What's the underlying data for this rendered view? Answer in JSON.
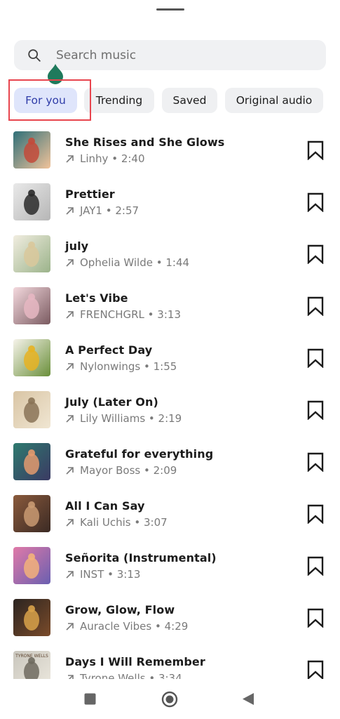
{
  "search": {
    "placeholder": "Search music"
  },
  "tabs": [
    {
      "label": "For you",
      "active": true
    },
    {
      "label": "Trending",
      "active": false
    },
    {
      "label": "Saved",
      "active": false
    },
    {
      "label": "Original audio",
      "active": false
    }
  ],
  "tracks": [
    {
      "title": "She Rises and She Glows",
      "artist": "Linhy",
      "duration": "2:40"
    },
    {
      "title": "Prettier",
      "artist": "JAY1",
      "duration": "2:57"
    },
    {
      "title": "july",
      "artist": "Ophelia Wilde",
      "duration": "1:44"
    },
    {
      "title": "Let's Vibe",
      "artist": "FRENCHGRL",
      "duration": "3:13"
    },
    {
      "title": "A Perfect Day",
      "artist": "Nylonwings",
      "duration": "1:55"
    },
    {
      "title": "July (Later On)",
      "artist": "Lily Williams",
      "duration": "2:19"
    },
    {
      "title": "Grateful for everything",
      "artist": "Mayor Boss",
      "duration": "2:09"
    },
    {
      "title": "All I Can Say",
      "artist": "Kali Uchis",
      "duration": "3:07"
    },
    {
      "title": "Señorita (Instrumental)",
      "artist": "INST",
      "duration": "3:13"
    },
    {
      "title": "Grow, Glow, Flow",
      "artist": "Auracle Vibes",
      "duration": "4:29"
    },
    {
      "title": "Days I Will Remember",
      "artist": "Tyrone Wells",
      "duration": "3:34"
    }
  ],
  "thumbnail_art": [
    {
      "text": "",
      "colors": [
        "#2f6f78",
        "#c34a3a",
        "#f1c39a"
      ]
    },
    {
      "text": "",
      "colors": [
        "#e9e9e9",
        "#2a2a2a",
        "#b6b6b6"
      ]
    },
    {
      "text": "",
      "colors": [
        "#f1ede0",
        "#d9c89b",
        "#9bb38a"
      ]
    },
    {
      "text": "",
      "colors": [
        "#f4d9de",
        "#e6b7c2",
        "#7a5a60"
      ]
    },
    {
      "text": "",
      "colors": [
        "#f6f3ea",
        "#e7b322",
        "#6a8f3a"
      ]
    },
    {
      "text": "",
      "colors": [
        "#d9c5a5",
        "#8a7357",
        "#f0e6d2"
      ]
    },
    {
      "text": "",
      "colors": [
        "#2e7a6f",
        "#e39a6e",
        "#3b3a63"
      ]
    },
    {
      "text": "",
      "colors": [
        "#8a5a3c",
        "#c99a72",
        "#3b2a24"
      ]
    },
    {
      "text": "",
      "colors": [
        "#e07aa8",
        "#f3b27a",
        "#6a5fb0"
      ]
    },
    {
      "text": "",
      "colors": [
        "#2b2420",
        "#d8a24a",
        "#7a4b2a"
      ]
    },
    {
      "text": "TYRONE WELLS",
      "colors": [
        "#c9c6bd",
        "#6f6a5f",
        "#ece8de"
      ]
    }
  ],
  "colors": {
    "accent_chip": "#dfe5fb",
    "accent_text": "#2f3ca8",
    "highlight_box": "#e8454e",
    "drop": "#1f7a5c"
  },
  "icons": {
    "search": "search-icon",
    "bookmark": "bookmark-icon",
    "trend": "arrow-up-right-icon",
    "nav": [
      "square-stop-icon",
      "home-circle-icon",
      "back-triangle-icon"
    ]
  }
}
